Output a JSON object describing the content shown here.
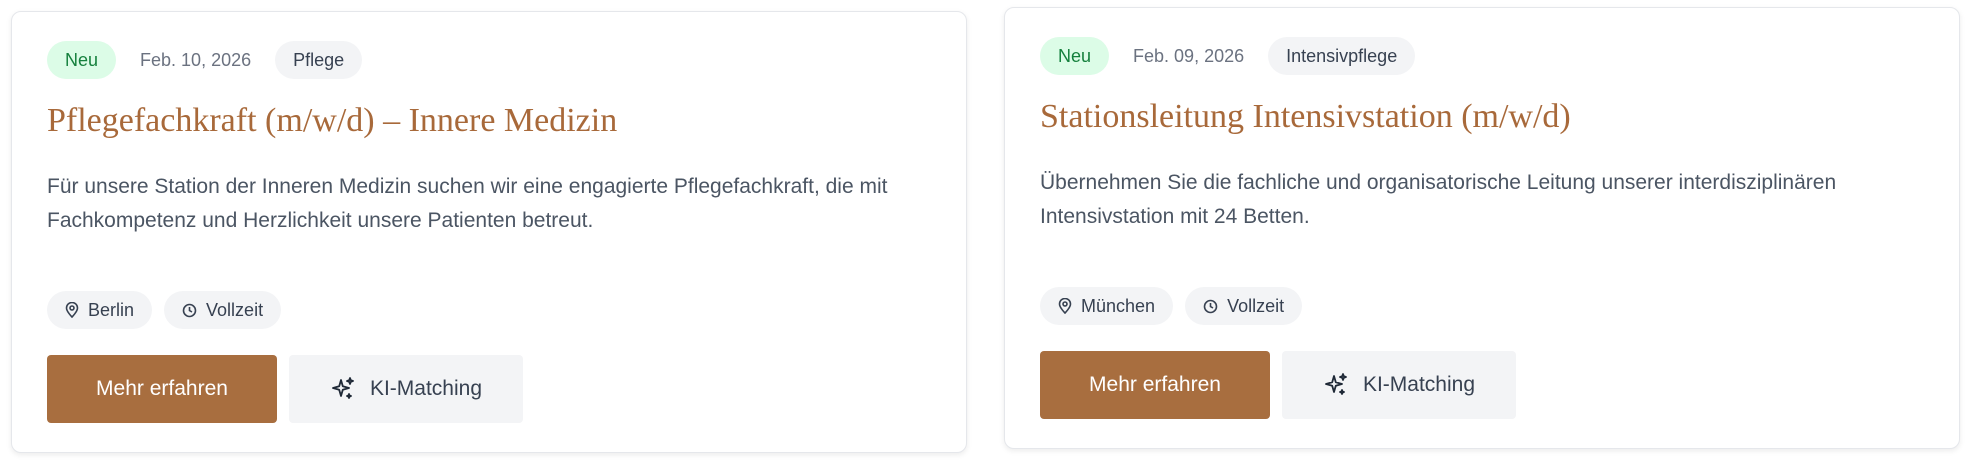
{
  "jobs": [
    {
      "badge": "Neu",
      "date": "Feb. 10, 2026",
      "category": "Pflege",
      "title": "Pflegefachkraft (m/w/d) – Innere Medizin",
      "description": "Für unsere Station der Inneren Medizin suchen wir eine engagierte Pflegefachkraft, die mit Fachkompetenz und Herzlichkeit unsere Patienten betreut.",
      "location": "Berlin",
      "employment": "Vollzeit",
      "primary_action": "Mehr erfahren",
      "secondary_action": "KI-Matching"
    },
    {
      "badge": "Neu",
      "date": "Feb. 09, 2026",
      "category": "Intensivpflege",
      "title": "Stationsleitung Intensivstation (m/w/d)",
      "description": "Übernehmen Sie die fachliche und organisatorische Leitung unserer interdisziplinären Intensivstation mit 24 Betten.",
      "location": "München",
      "employment": "Vollzeit",
      "primary_action": "Mehr erfahren",
      "secondary_action": "KI-Matching"
    }
  ],
  "colors": {
    "accent": "#a86e3f",
    "title": "#a8693a",
    "badge_new_bg": "#dcfce7",
    "badge_new_text": "#15803d",
    "pill_bg": "#f3f4f6"
  },
  "icons": {
    "location": "map-pin-icon",
    "employment": "clock-icon",
    "matching": "sparkles-icon"
  }
}
